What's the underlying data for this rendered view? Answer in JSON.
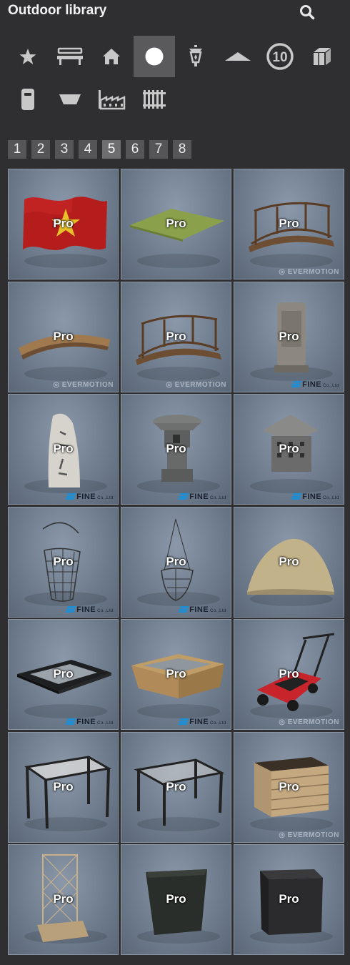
{
  "header": {
    "title": "Outdoor library",
    "search_icon": "search-icon"
  },
  "categories": [
    {
      "name": "favorites",
      "icon": "star-icon"
    },
    {
      "name": "bench",
      "icon": "bench-icon"
    },
    {
      "name": "house",
      "icon": "house-icon"
    },
    {
      "name": "circle",
      "icon": "circle-icon",
      "active": true
    },
    {
      "name": "lamp",
      "icon": "lantern-icon"
    },
    {
      "name": "canopy",
      "icon": "canopy-icon"
    },
    {
      "name": "sign",
      "icon": "speed-sign-icon",
      "label": "10"
    },
    {
      "name": "box",
      "icon": "box-icon"
    },
    {
      "name": "bin",
      "icon": "trash-bin-icon"
    },
    {
      "name": "planter",
      "icon": "planter-icon"
    },
    {
      "name": "factory",
      "icon": "factory-icon"
    },
    {
      "name": "fence",
      "icon": "fence-icon"
    }
  ],
  "pagination": {
    "pages": [
      "1",
      "2",
      "3",
      "4",
      "5",
      "6",
      "7",
      "8"
    ],
    "current": "5"
  },
  "items": [
    {
      "badge": "Pro",
      "thumb": "flag"
    },
    {
      "badge": "Pro",
      "thumb": "grass-mat"
    },
    {
      "badge": "Pro",
      "thumb": "railed-bridge",
      "watermark": "EVERMOTION"
    },
    {
      "badge": "Pro",
      "thumb": "arched-bridge",
      "watermark": "EVERMOTION"
    },
    {
      "badge": "Pro",
      "thumb": "railed-bridge",
      "watermark": "EVERMOTION"
    },
    {
      "badge": "Pro",
      "thumb": "stone-tablet",
      "watermark": "FINE",
      "watermark_sub": "Co.,Ltd"
    },
    {
      "badge": "Pro",
      "thumb": "inscribed-stone",
      "watermark": "FINE",
      "watermark_sub": "Co.,Ltd"
    },
    {
      "badge": "Pro",
      "thumb": "stone-lantern",
      "watermark": "FINE",
      "watermark_sub": "Co.,Ltd"
    },
    {
      "badge": "Pro",
      "thumb": "stone-lantern-box",
      "watermark": "FINE",
      "watermark_sub": "Co.,Ltd"
    },
    {
      "badge": "Pro",
      "thumb": "wire-basket",
      "watermark": "FINE",
      "watermark_sub": "Co.,Ltd"
    },
    {
      "badge": "Pro",
      "thumb": "hanging-basket",
      "watermark": "FINE",
      "watermark_sub": "Co.,Ltd"
    },
    {
      "badge": "Pro",
      "thumb": "sand-pile"
    },
    {
      "badge": "Pro",
      "thumb": "black-tray",
      "watermark": "FINE",
      "watermark_sub": "Co.,Ltd"
    },
    {
      "badge": "Pro",
      "thumb": "wooden-tray",
      "watermark": "FINE",
      "watermark_sub": "Co.,Ltd"
    },
    {
      "badge": "Pro",
      "thumb": "lawn-mower",
      "watermark": "EVERMOTION"
    },
    {
      "badge": "Pro",
      "thumb": "pergola-canvas"
    },
    {
      "badge": "Pro",
      "thumb": "pergola"
    },
    {
      "badge": "Pro",
      "thumb": "wooden-planter",
      "watermark": "EVERMOTION"
    },
    {
      "badge": "Pro",
      "thumb": "trellis-planter"
    },
    {
      "badge": "Pro",
      "thumb": "tapered-pot"
    },
    {
      "badge": "Pro",
      "thumb": "square-pot"
    }
  ],
  "colors": {
    "background": "#2f2f31",
    "active_category": "#5a5a5c",
    "page_button": "#555557",
    "tile_border": "#8b96a4"
  }
}
